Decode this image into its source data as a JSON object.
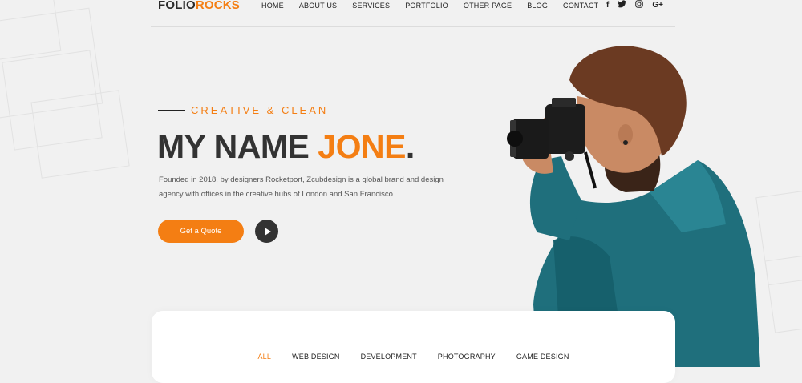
{
  "brand": {
    "part1": "FOLIO",
    "part2": "ROCKS"
  },
  "nav": [
    "HOME",
    "ABOUT US",
    "SERVICES",
    "PORTFOLIO",
    "OTHER PAGE",
    "BLOG",
    "CONTACT"
  ],
  "social": [
    "f",
    "twitter-icon",
    "instagram-icon",
    "G+"
  ],
  "hero": {
    "tagline": "CREATIVE & CLEAN",
    "headline_prefix": "MY NAME ",
    "headline_name": "JONE",
    "headline_suffix": ".",
    "description": "Founded in 2018, by designers Rocketport, Zcubdesign is a global brand and design agency with offices in the creative hubs of London and San Francisco.",
    "cta_label": "Get a Quote"
  },
  "filters": {
    "items": [
      "ALL",
      "WEB DESIGN",
      "DEVELOPMENT",
      "PHOTOGRAPHY",
      "GAME DESIGN"
    ],
    "active": "ALL"
  },
  "colors": {
    "accent": "#f47e13",
    "dark": "#333333",
    "background": "#f1f1f1"
  }
}
